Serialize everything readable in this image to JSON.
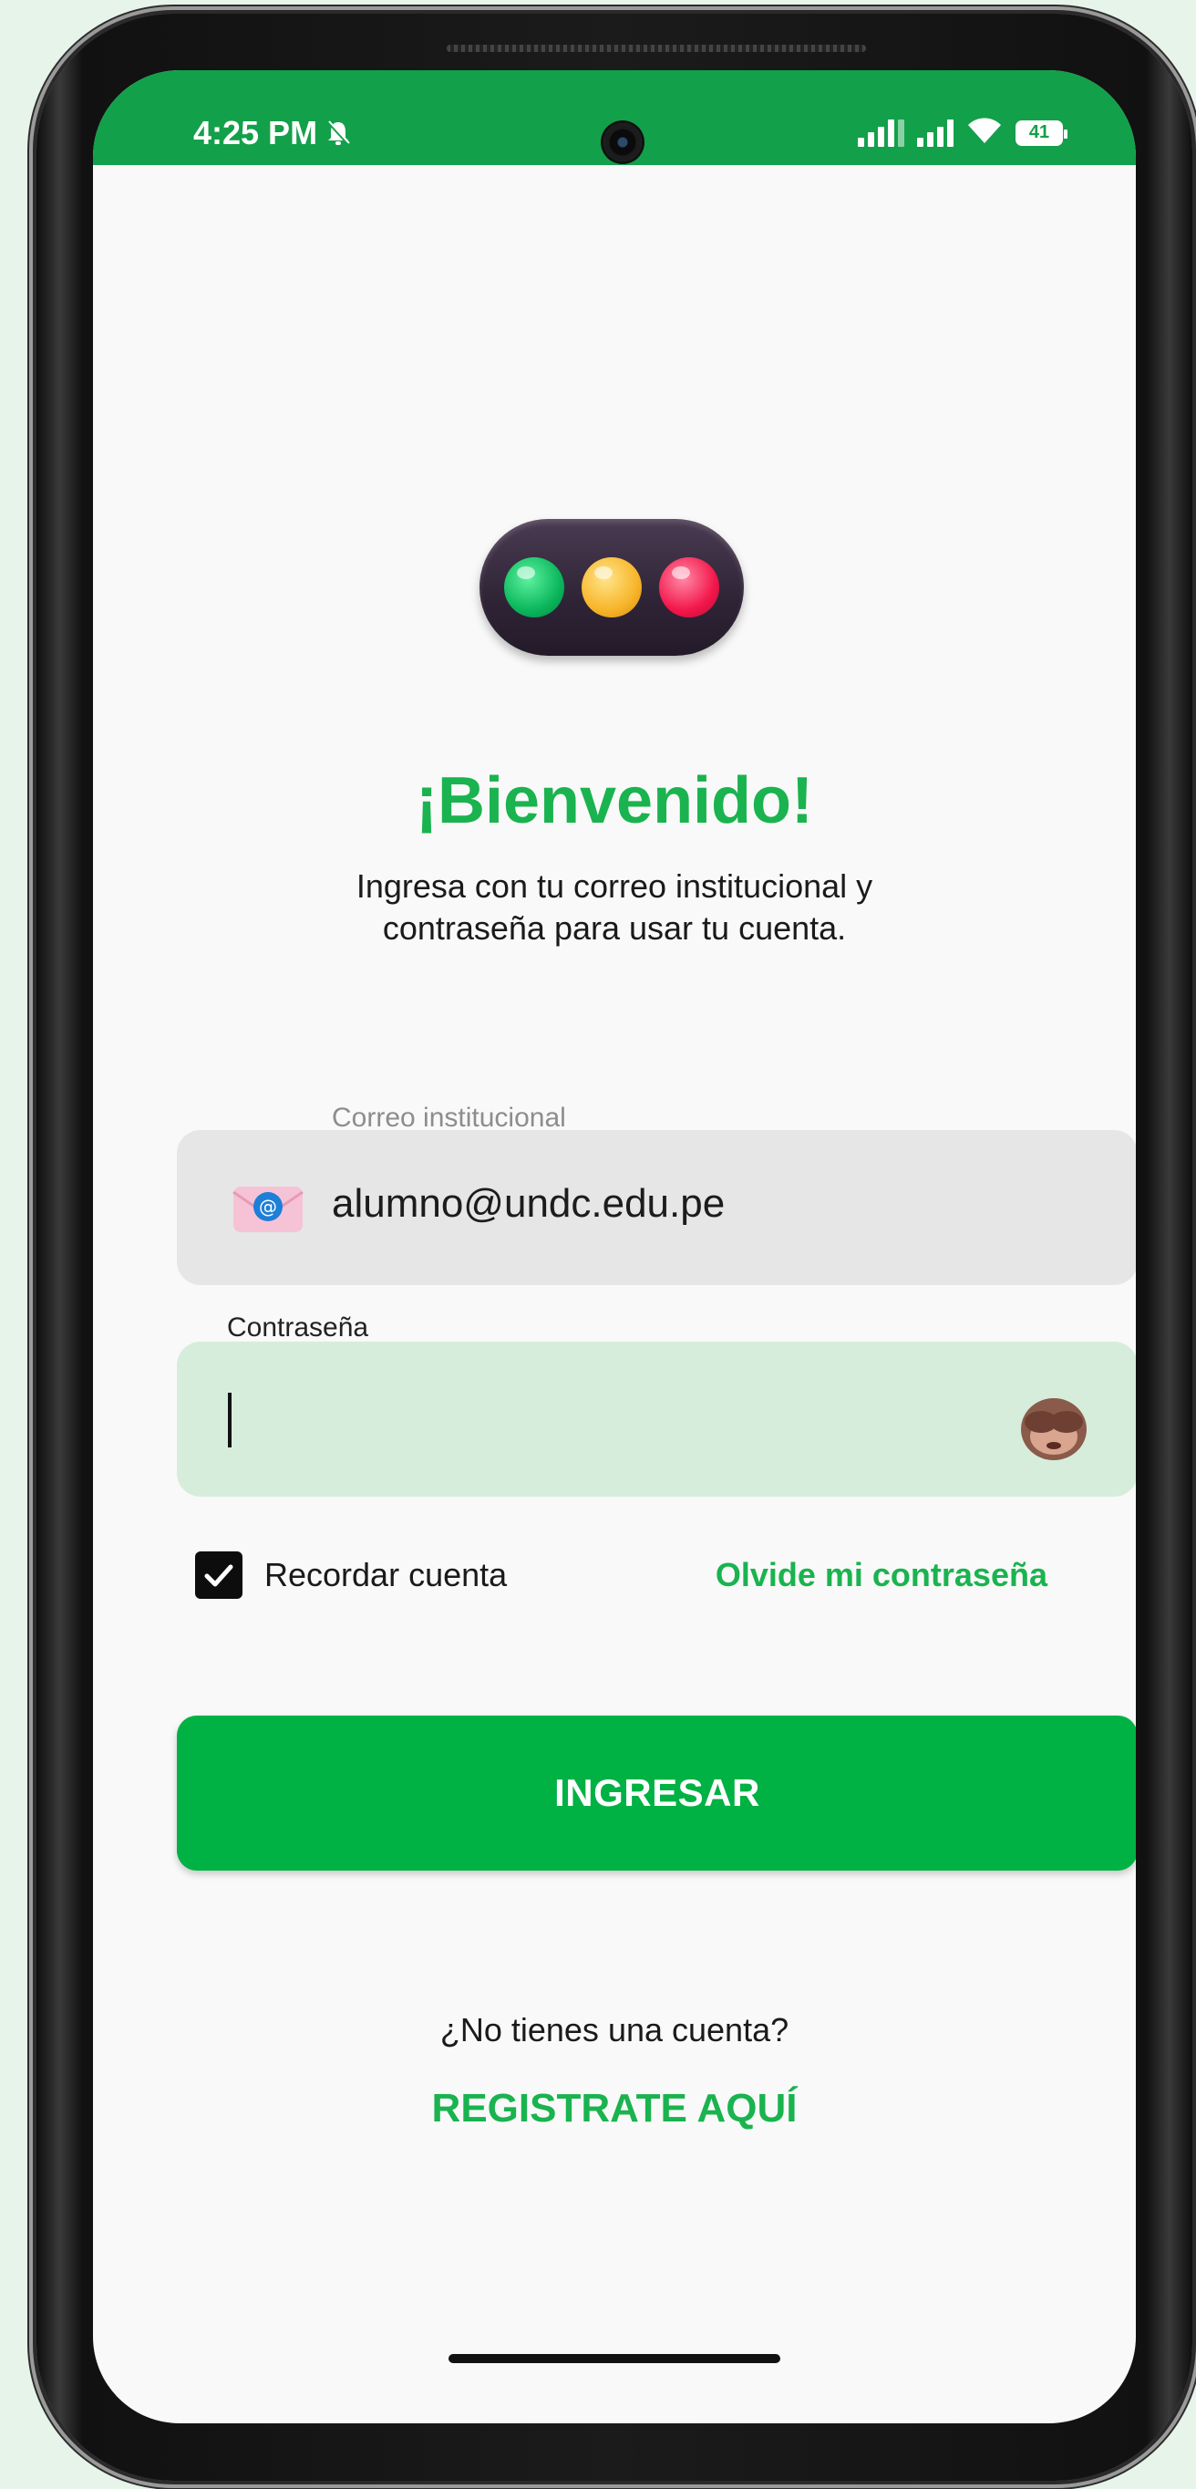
{
  "statusbar": {
    "time": "4:25 PM",
    "battery": "41",
    "icons": [
      "bell-mute-icon",
      "signal-icon",
      "signal-icon",
      "wifi-icon",
      "battery-icon"
    ]
  },
  "login": {
    "title": "¡Bienvenido!",
    "subtitle": "Ingresa con tu correo institucional y\ncontraseña para usar tu cuenta.",
    "email_label": "Correo institucional",
    "email_value": "alumno@undc.edu.pe",
    "password_label": "Contraseña",
    "password_value": "",
    "remember_label": "Recordar cuenta",
    "remember_checked": true,
    "forgot_label": "Olvide mi contraseña",
    "submit_label": "INGRESAR",
    "no_account_text": "¿No tienes una cuenta?",
    "register_label": "REGISTRATE AQUÍ"
  },
  "colors": {
    "accent": "#1ab34f",
    "button": "#00b144",
    "statusbar": "#13a04a",
    "email_field": "#e6e6e6",
    "password_field": "#d6eddb"
  }
}
